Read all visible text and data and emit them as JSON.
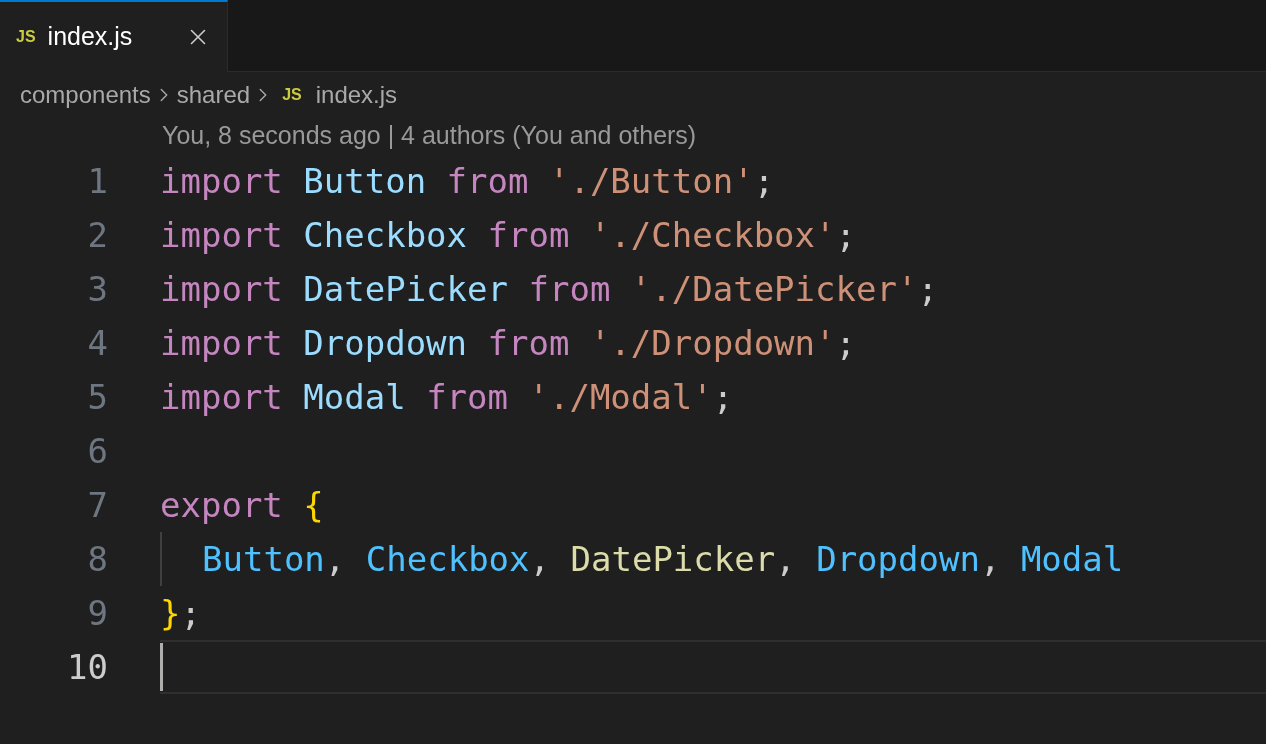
{
  "tabs": [
    {
      "label": "index.js",
      "icon_text": "JS",
      "selected": true
    }
  ],
  "breadcrumb": [
    {
      "label": "components"
    },
    {
      "label": "shared"
    },
    {
      "label": "index.js",
      "icon_text": "JS"
    }
  ],
  "blame": "You, 8 seconds ago | 4 authors (You and others)",
  "lines": [
    {
      "number": "1",
      "active": false,
      "tokens": [
        {
          "kind": "keyword",
          "text": "import "
        },
        {
          "kind": "variable",
          "text": "Button "
        },
        {
          "kind": "keyword",
          "text": "from "
        },
        {
          "kind": "string",
          "text": "'./Button'"
        },
        {
          "kind": "plain",
          "text": ";"
        }
      ]
    },
    {
      "number": "2",
      "active": false,
      "tokens": [
        {
          "kind": "keyword",
          "text": "import "
        },
        {
          "kind": "variable",
          "text": "Checkbox "
        },
        {
          "kind": "keyword",
          "text": "from "
        },
        {
          "kind": "string",
          "text": "'./Checkbox'"
        },
        {
          "kind": "plain",
          "text": ";"
        }
      ]
    },
    {
      "number": "3",
      "active": false,
      "tokens": [
        {
          "kind": "keyword",
          "text": "import "
        },
        {
          "kind": "variable",
          "text": "DatePicker "
        },
        {
          "kind": "keyword",
          "text": "from "
        },
        {
          "kind": "string",
          "text": "'./DatePicker'"
        },
        {
          "kind": "plain",
          "text": ";"
        }
      ]
    },
    {
      "number": "4",
      "active": false,
      "tokens": [
        {
          "kind": "keyword",
          "text": "import "
        },
        {
          "kind": "variable",
          "text": "Dropdown "
        },
        {
          "kind": "keyword",
          "text": "from "
        },
        {
          "kind": "string",
          "text": "'./Dropdown'"
        },
        {
          "kind": "plain",
          "text": ";"
        }
      ]
    },
    {
      "number": "5",
      "active": false,
      "tokens": [
        {
          "kind": "keyword",
          "text": "import "
        },
        {
          "kind": "variable",
          "text": "Modal "
        },
        {
          "kind": "keyword",
          "text": "from "
        },
        {
          "kind": "string",
          "text": "'./Modal'"
        },
        {
          "kind": "plain",
          "text": ";"
        }
      ]
    },
    {
      "number": "6",
      "active": false
    },
    {
      "number": "7",
      "active": false,
      "tokens": [
        {
          "kind": "keyword",
          "text": "export "
        },
        {
          "kind": "bracket",
          "text": "{"
        }
      ]
    },
    {
      "number": "8",
      "active": false,
      "indented": true,
      "tokens": [
        {
          "kind": "constant",
          "text": "Button"
        },
        {
          "kind": "plain",
          "text": ", "
        },
        {
          "kind": "constant",
          "text": "Checkbox"
        },
        {
          "kind": "plain",
          "text": ", "
        },
        {
          "kind": "function",
          "text": "DatePicker"
        },
        {
          "kind": "plain",
          "text": ", "
        },
        {
          "kind": "constant",
          "text": "Dropdown"
        },
        {
          "kind": "plain",
          "text": ", "
        },
        {
          "kind": "constant",
          "text": "Modal"
        }
      ]
    },
    {
      "number": "9",
      "active": false,
      "tokens": [
        {
          "kind": "bracket",
          "text": "}"
        },
        {
          "kind": "plain",
          "text": ";"
        }
      ]
    },
    {
      "number": "10",
      "active": true
    }
  ]
}
